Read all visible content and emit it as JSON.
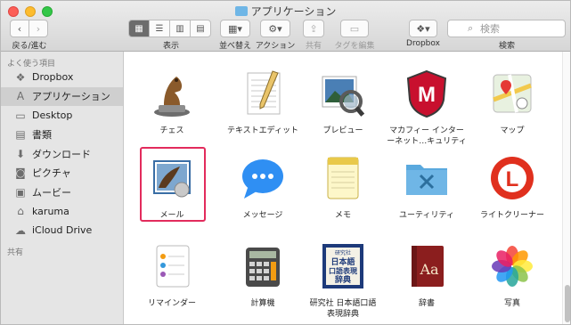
{
  "window": {
    "title": "アプリケーション"
  },
  "toolbar": {
    "back_forward_label": "戻る/進む",
    "view_label": "表示",
    "arrange_label": "並べ替え",
    "action_label": "アクション",
    "share_label": "共有",
    "tags_label": "タグを編集",
    "dropbox_label": "Dropbox",
    "search_label": "検索",
    "search_placeholder": "検索"
  },
  "sidebar": {
    "favorites_heading": "よく使う項目",
    "items": [
      {
        "label": "Dropbox",
        "icon": "dropbox-icon"
      },
      {
        "label": "アプリケーション",
        "icon": "applications-icon",
        "selected": true
      },
      {
        "label": "Desktop",
        "icon": "desktop-icon"
      },
      {
        "label": "書類",
        "icon": "documents-icon"
      },
      {
        "label": "ダウンロード",
        "icon": "downloads-icon"
      },
      {
        "label": "ピクチャ",
        "icon": "pictures-icon"
      },
      {
        "label": "ムービー",
        "icon": "movies-icon"
      },
      {
        "label": "karuma",
        "icon": "home-icon"
      },
      {
        "label": "iCloud Drive",
        "icon": "icloud-icon"
      }
    ],
    "shared_heading": "共有"
  },
  "apps": [
    {
      "label": "チェス",
      "icon": "chess-icon"
    },
    {
      "label": "テキストエディット",
      "icon": "textedit-icon"
    },
    {
      "label": "プレビュー",
      "icon": "preview-icon"
    },
    {
      "label": "マカフィー インター\nーネット…キュリティ",
      "icon": "mcafee-icon"
    },
    {
      "label": "マップ",
      "icon": "maps-icon"
    },
    {
      "label": "メール",
      "icon": "mail-icon",
      "highlighted": true
    },
    {
      "label": "メッセージ",
      "icon": "messages-icon"
    },
    {
      "label": "メモ",
      "icon": "notes-icon"
    },
    {
      "label": "ユーティリティ",
      "icon": "utilities-folder-icon"
    },
    {
      "label": "ライトクリーナー",
      "icon": "lite-cleaner-icon"
    },
    {
      "label": "リマインダー",
      "icon": "reminders-icon"
    },
    {
      "label": "計算機",
      "icon": "calculator-icon"
    },
    {
      "label": "研究社 日本語口語\n表現辞典",
      "icon": "kenkyusha-dictionary-icon"
    },
    {
      "label": "辞書",
      "icon": "dictionary-icon"
    },
    {
      "label": "写真",
      "icon": "photos-icon"
    }
  ],
  "dictionary_icon_text": [
    "研究社",
    "日本語",
    "口語表現",
    "辞典"
  ],
  "dict_book_text": "Aa",
  "colors": {
    "highlight": "#e22b5c",
    "selection": "#cfcfcf",
    "folder": "#6fb6e6"
  }
}
